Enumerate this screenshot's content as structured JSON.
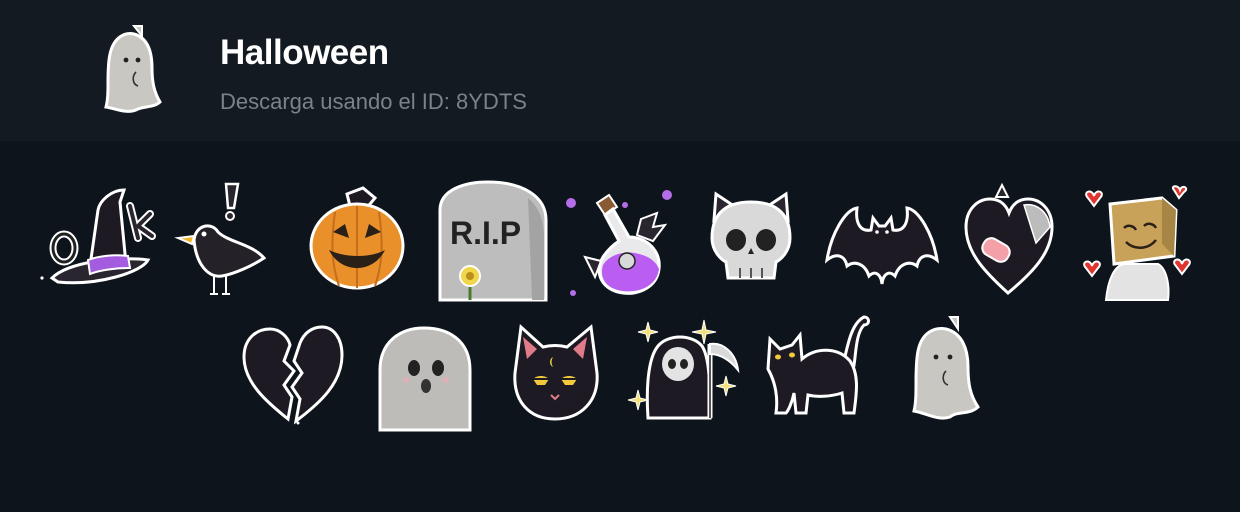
{
  "pack": {
    "title": "Halloween",
    "subtitle": "Descarga usando el ID: 8YDTS"
  },
  "stickers": [
    {
      "name": "witch-hat-ok"
    },
    {
      "name": "crow-exclamation"
    },
    {
      "name": "jack-o-lantern"
    },
    {
      "name": "rip-tombstone",
      "text": "R.I.P"
    },
    {
      "name": "potion-bottle"
    },
    {
      "name": "skull-cat-ears"
    },
    {
      "name": "bat"
    },
    {
      "name": "bandaged-heart"
    },
    {
      "name": "box-head-love"
    },
    {
      "name": "broken-heart"
    },
    {
      "name": "surprised-ghost"
    },
    {
      "name": "black-cat-face"
    },
    {
      "name": "grim-reaper"
    },
    {
      "name": "black-cat-arched"
    },
    {
      "name": "little-ghost"
    }
  ]
}
